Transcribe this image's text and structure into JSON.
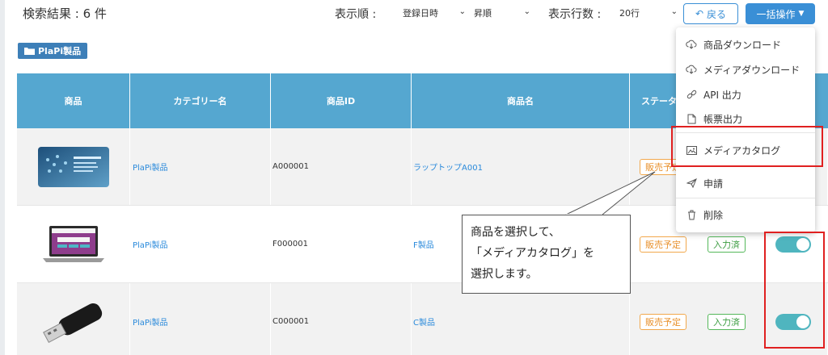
{
  "toolbar": {
    "result_count": "検索結果 : 6 件",
    "sort_label": "表示順 :",
    "sort_order_value": "登録日時",
    "sort_dir_value": "昇順",
    "rows_label": "表示行数 :",
    "rows_value": "20行",
    "back_label": "戻る",
    "bulk_label": "一括操作"
  },
  "folder": {
    "label": "PlaPi製品"
  },
  "table": {
    "headers": [
      "商品",
      "カテゴリー名",
      "商品ID",
      "商品名",
      "ステータ"
    ],
    "rows": [
      {
        "category": "PlaPi製品",
        "id": "A000001",
        "name": "ラップトップA001",
        "status": "販売予定",
        "image": "website-banner-thumbnail"
      },
      {
        "category": "PlaPi製品",
        "id": "F000001",
        "name": "F製品",
        "status": "販売予定",
        "input_status": "入力済",
        "toggle_on": true,
        "image": "laptop-thumbnail"
      },
      {
        "category": "PlaPi製品",
        "id": "C000001",
        "name": "C製品",
        "status": "販売予定",
        "input_status": "入力済",
        "toggle_on": true,
        "image": "usb-drive-thumbnail"
      }
    ]
  },
  "menu": {
    "items": [
      {
        "label": "商品ダウンロード",
        "icon": "cloud-download-icon"
      },
      {
        "label": "メディアダウンロード",
        "icon": "cloud-download-icon"
      },
      {
        "label": "API 出力",
        "icon": "link-icon"
      },
      {
        "label": "帳票出力",
        "icon": "document-icon"
      },
      {
        "label": "メディアカタログ",
        "icon": "image-icon"
      },
      {
        "label": "申請",
        "icon": "send-icon"
      },
      {
        "label": "削除",
        "icon": "trash-icon"
      }
    ]
  },
  "callout": {
    "line1": "商品を選択して、",
    "line2": "「メディアカタログ」を",
    "line3": "選択します。"
  },
  "colors": {
    "header_blue": "#55a7d0",
    "primary_blue": "#3a8fd6",
    "highlight_red": "#e02020",
    "toggle_teal": "#4fb5bf"
  }
}
